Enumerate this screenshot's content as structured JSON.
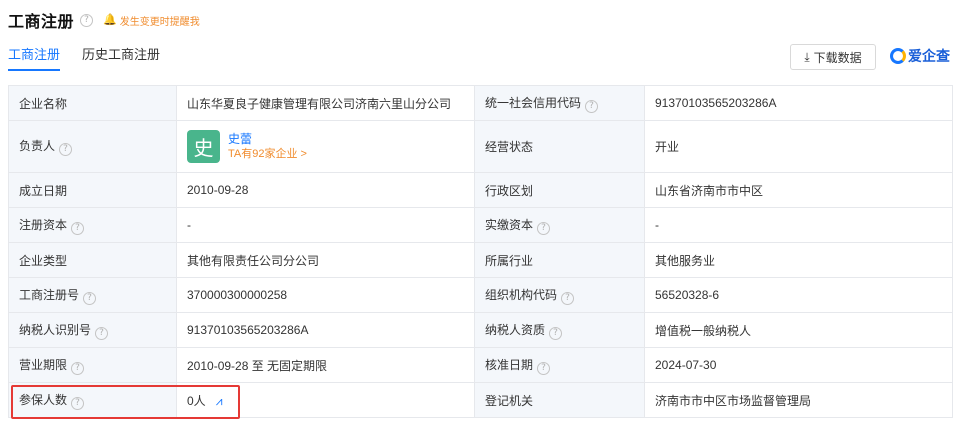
{
  "header": {
    "title": "工商注册",
    "help": "?",
    "notice": "发生变更时提醒我",
    "bell_icon": "🔔"
  },
  "tabs": [
    {
      "label": "工商注册",
      "active": true
    },
    {
      "label": "历史工商注册",
      "active": false
    }
  ],
  "toolbar": {
    "download_label": "下载数据",
    "download_icon": "⤓"
  },
  "brand": {
    "name": "爱企查"
  },
  "colors": {
    "accent": "#1677ff",
    "orange": "#f08c2e",
    "avatar": "#49b58c",
    "highlight": "#e53935",
    "label_bg": "#f4f7fb"
  },
  "rows": {
    "company_name": {
      "label": "企业名称",
      "value": "山东华夏良子健康管理有限公司济南六里山分公司"
    },
    "credit_code": {
      "label": "统一社会信用代码",
      "value": "91370103565203286A"
    },
    "legal": {
      "label": "负责人",
      "avatar_char": "史",
      "name": "史蕾",
      "meta": "TA有92家企业 >"
    },
    "status": {
      "label": "经营状态",
      "value": "开业"
    },
    "founded": {
      "label": "成立日期",
      "value": "2010-09-28"
    },
    "region": {
      "label": "行政区划",
      "value": "山东省济南市市中区"
    },
    "reg_capital": {
      "label": "注册资本",
      "value": "-"
    },
    "paid_capital": {
      "label": "实缴资本",
      "value": "-"
    },
    "type": {
      "label": "企业类型",
      "value": "其他有限责任公司分公司"
    },
    "industry": {
      "label": "所属行业",
      "value": "其他服务业"
    },
    "reg_no": {
      "label": "工商注册号",
      "value": "370000300000258"
    },
    "org_code": {
      "label": "组织机构代码",
      "value": "56520328-6"
    },
    "tax_id": {
      "label": "纳税人识别号",
      "value": "91370103565203286A"
    },
    "tax_quality": {
      "label": "纳税人资质",
      "value": "增值税一般纳税人"
    },
    "term": {
      "label": "营业期限",
      "value": "2010-09-28 至 无固定期限"
    },
    "approved": {
      "label": "核准日期",
      "value": "2024-07-30"
    },
    "insured": {
      "label": "参保人数",
      "value": "0人",
      "trend_icon": "⩘"
    },
    "authority": {
      "label": "登记机关",
      "value": "济南市市中区市场监督管理局"
    }
  }
}
